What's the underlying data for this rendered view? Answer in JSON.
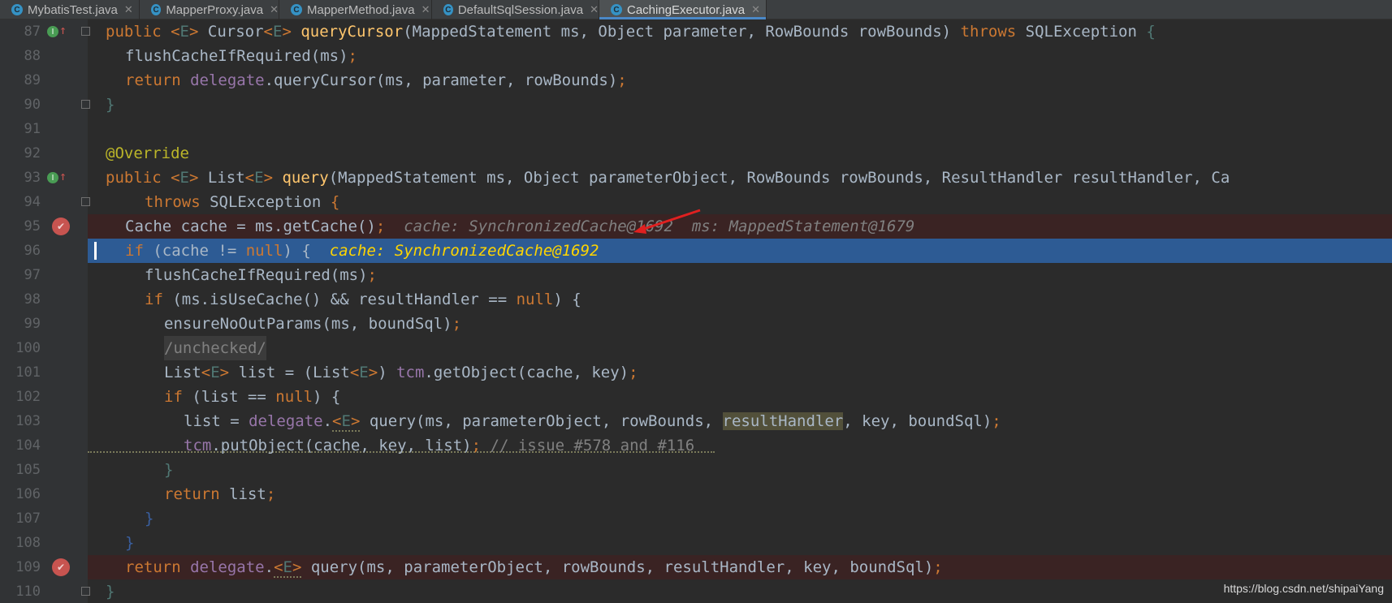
{
  "tabs": [
    {
      "label": "MybatisTest.java",
      "icon": "C",
      "active": false
    },
    {
      "label": "MapperProxy.java",
      "icon": "C",
      "active": false
    },
    {
      "label": "MapperMethod.java",
      "icon": "C",
      "active": false
    },
    {
      "label": "DefaultSqlSession.java",
      "icon": "C",
      "active": false
    },
    {
      "label": "CachingExecutor.java",
      "icon": "C",
      "active": true
    }
  ],
  "lines": [
    {
      "num": "87",
      "marker": "override",
      "fold": true
    },
    {
      "num": "88"
    },
    {
      "num": "89"
    },
    {
      "num": "90",
      "fold": true
    },
    {
      "num": "91"
    },
    {
      "num": "92"
    },
    {
      "num": "93",
      "marker": "override",
      "fold": false
    },
    {
      "num": "94",
      "fold": true
    },
    {
      "num": "95",
      "marker": "breakpoint"
    },
    {
      "num": "96"
    },
    {
      "num": "97"
    },
    {
      "num": "98"
    },
    {
      "num": "99"
    },
    {
      "num": "100"
    },
    {
      "num": "101"
    },
    {
      "num": "102"
    },
    {
      "num": "103"
    },
    {
      "num": "104"
    },
    {
      "num": "105"
    },
    {
      "num": "106"
    },
    {
      "num": "107"
    },
    {
      "num": "108"
    },
    {
      "num": "109",
      "marker": "breakpoint"
    },
    {
      "num": "110",
      "fold": true
    }
  ],
  "code": {
    "l87": {
      "public": "public",
      "generic_open": "<",
      "E": "E",
      "generic_close": ">",
      "cursor_type": "Cursor",
      "method": "queryCursor",
      "params": "(MappedStatement ms, Object parameter, RowBounds rowBounds)",
      "throws": "throws",
      "exc": "SQLException",
      "brace": "{"
    },
    "l88": {
      "call": "flushCacheIfRequired",
      "args": "(ms)",
      "semi": ";"
    },
    "l89": {
      "ret": "return",
      "delegate": "delegate",
      "rest": ".queryCursor(ms, parameter, rowBounds)",
      "semi": ";"
    },
    "l90": {
      "brace": "}"
    },
    "l92": {
      "ann": "@Override"
    },
    "l93": {
      "public": "public",
      "list_type": "List",
      "method": "query",
      "params": "(MappedStatement ms, Object parameterObject, RowBounds rowBounds, ResultHandler resultHandler, Ca"
    },
    "l94": {
      "throws": "throws",
      "exc": "SQLException",
      "brace": "{"
    },
    "l95": {
      "code": "Cache cache = ms.getCache()",
      "semi": ";",
      "inlay1": "cache: SynchronizedCache@1692",
      "inlay2": "ms: MappedStatement@1679"
    },
    "l96": {
      "kw": "if",
      "code": " (cache != ",
      "null": "null",
      "close": ") {",
      "inlay": "cache: SynchronizedCache@1692"
    },
    "l97": {
      "call": "flushCacheIfRequired(ms)",
      "semi": ";"
    },
    "l98": {
      "kw": "if",
      "code": " (ms.isUseCache() && resultHandler == ",
      "null": "null",
      "close": ") {"
    },
    "l99": {
      "call": "ensureNoOutParams(ms, boundSql)",
      "semi": ";"
    },
    "l100": {
      "text": "/unchecked/"
    },
    "l101": {
      "pre": "List",
      "mid": " list = (List",
      "post": ") ",
      "tcm": "tcm",
      "call": ".getObject(cache, key)",
      "semi": ";"
    },
    "l102": {
      "kw": "if",
      "code": " (list == ",
      "null": "null",
      "close": ") {"
    },
    "l103": {
      "pre": "list = ",
      "delegate": "delegate",
      "dot": ".",
      "call": " query(ms, parameterObject, rowBounds, ",
      "hl": "resultHandler",
      "post": ", key, boundSql)",
      "semi": ";"
    },
    "l104": {
      "tcm": "tcm",
      "call": ".putObject(cache, key, list)",
      "semi": ";",
      "cmt": " // issue #578 and #116"
    },
    "l105": {
      "brace": "}"
    },
    "l106": {
      "ret": "return",
      "code": " list",
      "semi": ";"
    },
    "l107": {
      "brace": "}"
    },
    "l108": {
      "brace": "}"
    },
    "l109": {
      "ret": "return",
      "delegate": "delegate",
      "dot": ".",
      "call": " query(ms, parameterObject, rowBounds, resultHandler, key, boundSql)",
      "semi": ";"
    },
    "l110": {
      "brace": "}"
    }
  },
  "watermark": "https://blog.csdn.net/shipaiYang",
  "colors": {
    "background": "#2b2b2b",
    "keyword": "#cc7832",
    "method": "#ffc66d",
    "field": "#9876aa",
    "annotation": "#bbb529",
    "execution_line": "#2d5b94",
    "breakpoint": "#c75450",
    "arrow": "#e02020"
  }
}
